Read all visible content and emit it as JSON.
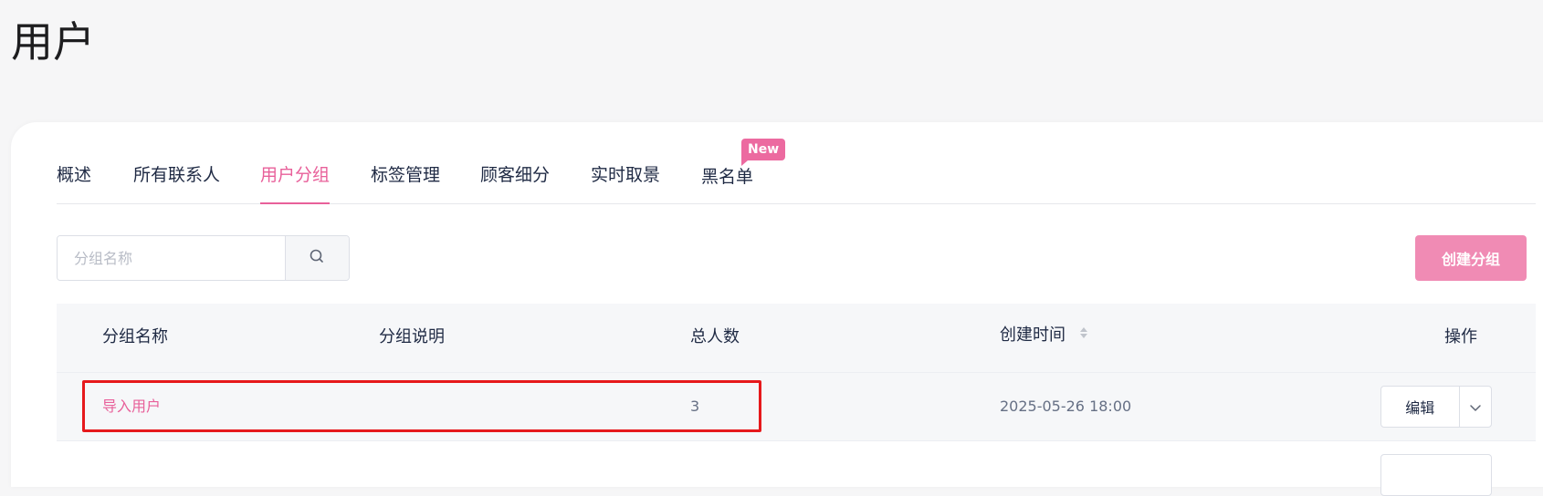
{
  "page": {
    "title": "用户"
  },
  "tabs": [
    {
      "label": "概述",
      "active": false
    },
    {
      "label": "所有联系人",
      "active": false
    },
    {
      "label": "用户分组",
      "active": true
    },
    {
      "label": "标签管理",
      "active": false
    },
    {
      "label": "顾客细分",
      "active": false
    },
    {
      "label": "实时取景",
      "active": false
    },
    {
      "label": "黑名单",
      "active": false,
      "badge": "New"
    }
  ],
  "toolbar": {
    "search_placeholder": "分组名称",
    "search_value": "",
    "search_icon": "search-icon",
    "create_label": "创建分组"
  },
  "table": {
    "columns": [
      "分组名称",
      "分组说明",
      "总人数",
      "创建时间",
      "操作"
    ],
    "sortable_column": "创建时间",
    "rows": [
      {
        "name": "导入用户",
        "description": "",
        "total": "3",
        "created_at": "2025-05-26 18:00",
        "action_label": "编辑",
        "highlighted": true
      }
    ]
  },
  "colors": {
    "accent": "#e8609a",
    "primary_button": "#f08bb4",
    "badge": "#ec6aa0",
    "highlight_border": "#e6191c"
  }
}
